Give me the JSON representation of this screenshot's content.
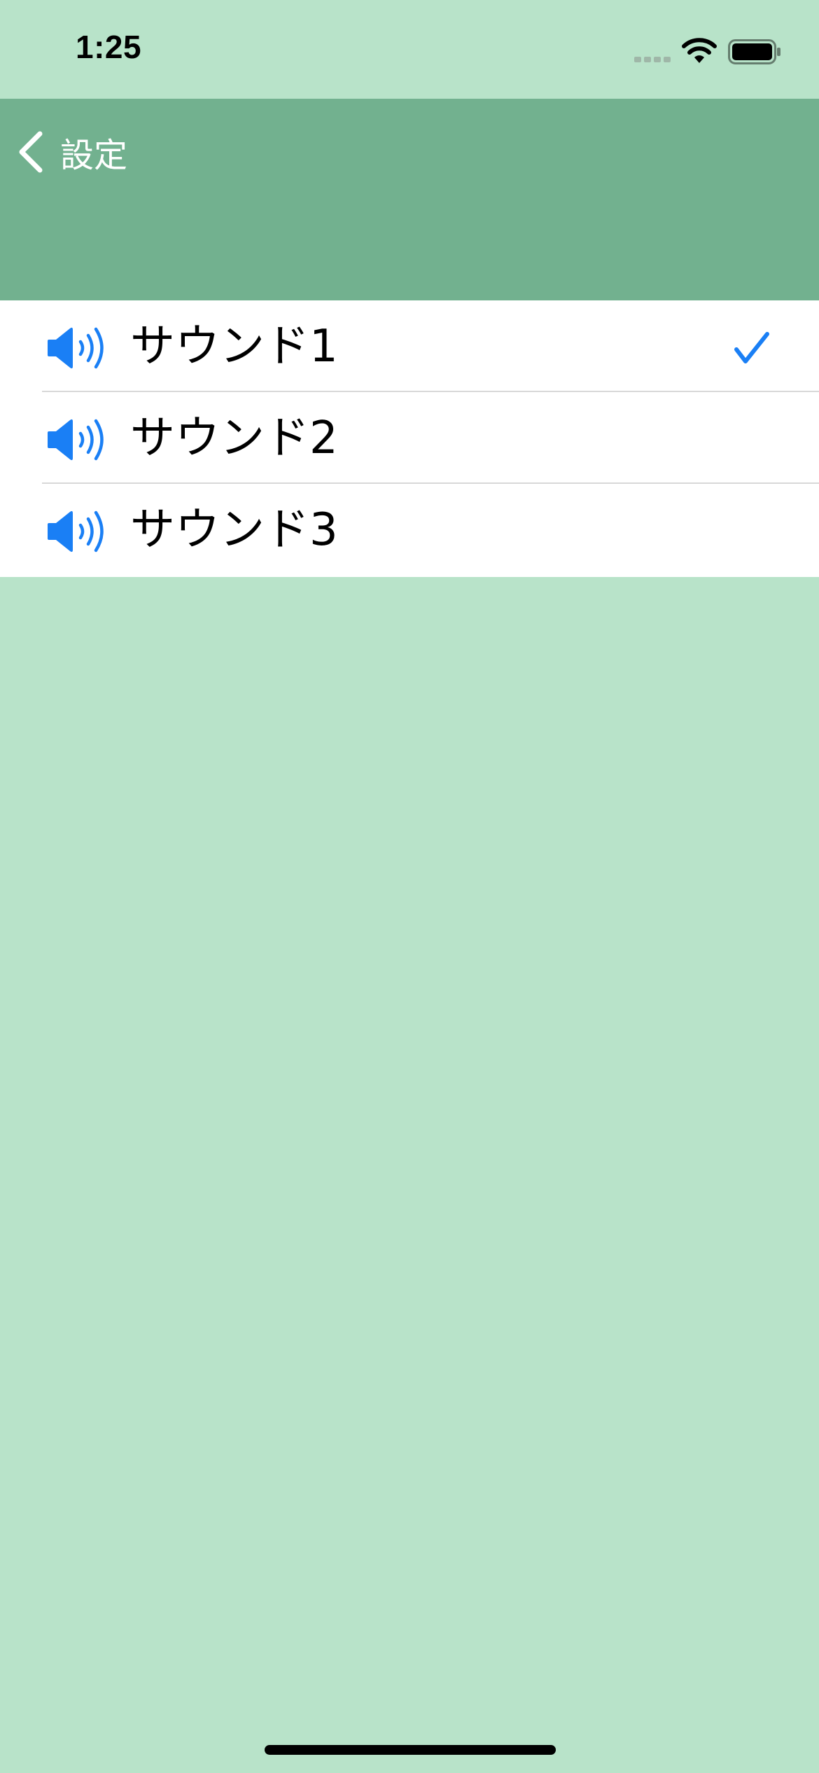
{
  "status_bar": {
    "time": "1:25"
  },
  "nav_bar": {
    "back_label": "設定"
  },
  "sound_list": {
    "items": [
      {
        "label": "サウンド1",
        "selected": true
      },
      {
        "label": "サウンド2",
        "selected": false
      },
      {
        "label": "サウンド3",
        "selected": false
      }
    ]
  },
  "colors": {
    "background": "#b8e3c9",
    "nav_bar": "#72b18f",
    "accent": "#1a7ff5"
  }
}
